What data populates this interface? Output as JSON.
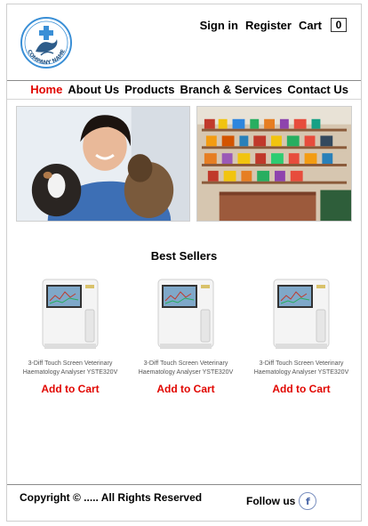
{
  "brand": {
    "logo_text": "COMPANY NAME"
  },
  "header": {
    "signin": "Sign in",
    "register": "Register",
    "cart": "Cart",
    "cart_count": "0"
  },
  "nav": {
    "items": [
      "Home",
      "About Us",
      "Products",
      "Branch & Services",
      "Contact Us"
    ],
    "active": "Home"
  },
  "best_sellers": {
    "title": "Best Sellers",
    "products": [
      {
        "name": "3-Diff Touch Screen Veterinary Haematology Analyser YSTE320V",
        "button": "Add to Cart"
      },
      {
        "name": "3-Diff Touch Screen Veterinary Haematology Analyser YSTE320V",
        "button": "Add to Cart"
      },
      {
        "name": "3-Diff Touch Screen Veterinary Haematology Analyser YSTE320V",
        "button": "Add to Cart"
      }
    ]
  },
  "footer": {
    "copyright": "Copyright © ..... All Rights Reserved",
    "follow": "Follow us",
    "social_icon": "facebook-icon"
  },
  "colors": {
    "accent": "#e10600",
    "logo_blue": "#3a8fd6"
  }
}
